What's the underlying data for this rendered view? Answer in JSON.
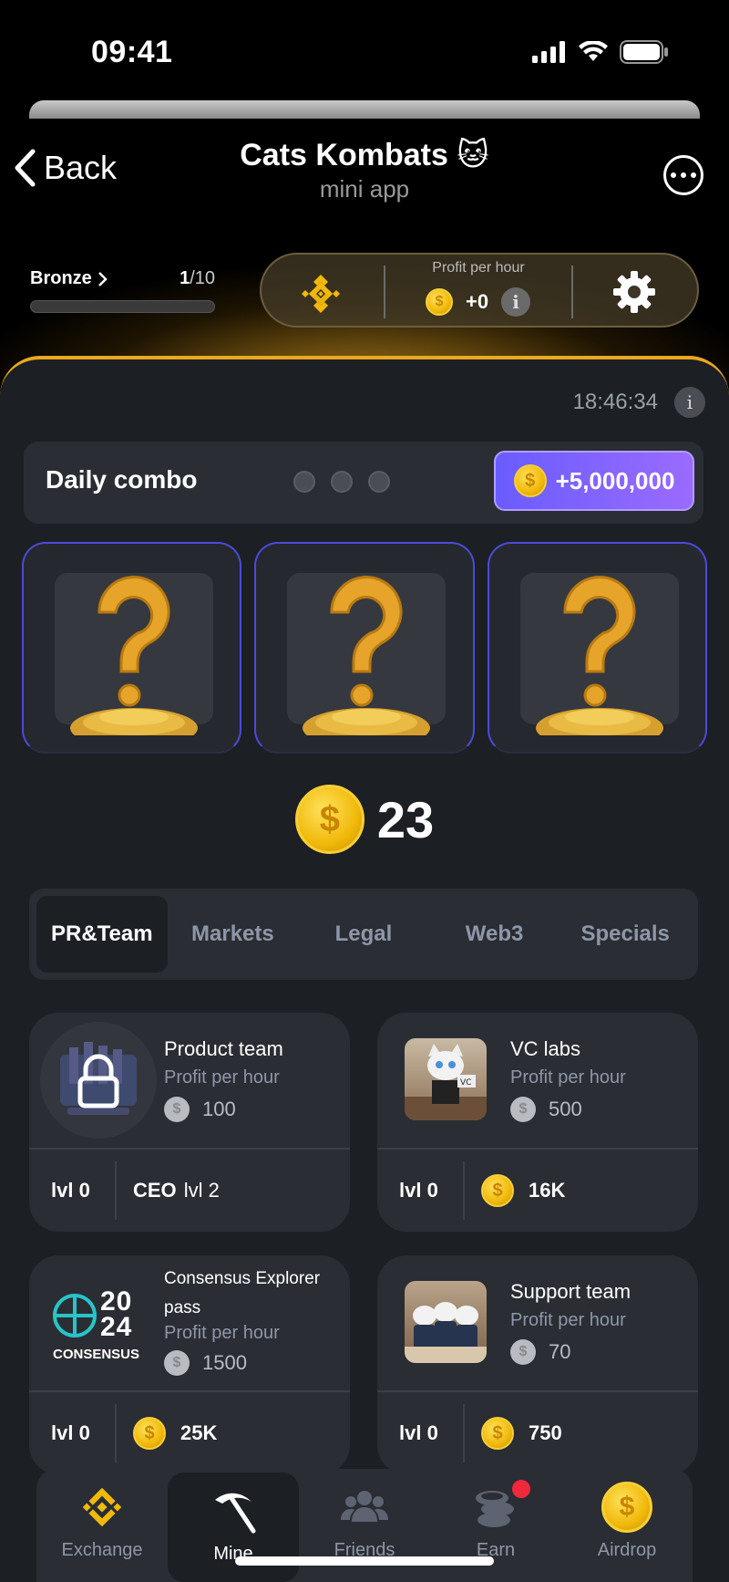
{
  "status_bar": {
    "time": "09:41"
  },
  "header": {
    "back_label": "Back",
    "title": "Cats Kombats 🐱",
    "subtitle": "mini app"
  },
  "level": {
    "name": "Bronze",
    "current": "1",
    "total": "/10",
    "progress": 0.0
  },
  "profit_pill": {
    "label": "Profit per hour",
    "value": "+0",
    "info": "i"
  },
  "timer": {
    "value": "18:46:34",
    "info": "i"
  },
  "daily_combo": {
    "title": "Daily combo",
    "reward": "+5,000,000",
    "slots_filled": 0,
    "slots_total": 3
  },
  "balance": {
    "value": "23"
  },
  "tabs": [
    {
      "label": "PR&Team",
      "active": true
    },
    {
      "label": "Markets",
      "active": false
    },
    {
      "label": "Legal",
      "active": false
    },
    {
      "label": "Web3",
      "active": false
    },
    {
      "label": "Specials",
      "active": false
    }
  ],
  "cards": [
    {
      "name": "Product team",
      "profit_label": "Profit per hour",
      "profit": "100",
      "level": "lvl 0",
      "cost_prefix": "CEO",
      "cost": "lvl 2",
      "locked": true
    },
    {
      "name": "VC labs",
      "profit_label": "Profit per hour",
      "profit": "500",
      "level": "lvl 0",
      "cost": "16K",
      "locked": false
    },
    {
      "name": "Consensus Explorer pass",
      "profit_label": "Profit per hour",
      "profit": "1500",
      "level": "lvl 0",
      "cost": "25K",
      "locked": false,
      "logo_text_top": "20",
      "logo_text_mid": "24",
      "logo_text_bottom": "CONSENSUS"
    },
    {
      "name": "Support team",
      "profit_label": "Profit per hour",
      "profit": "70",
      "level": "lvl 0",
      "cost": "750",
      "locked": false
    }
  ],
  "nav": [
    {
      "label": "Exchange",
      "icon": "binance-icon",
      "active": false
    },
    {
      "label": "Mine",
      "icon": "pickaxe-icon",
      "active": true
    },
    {
      "label": "Friends",
      "icon": "friends-icon",
      "active": false
    },
    {
      "label": "Earn",
      "icon": "coins-icon",
      "active": false,
      "badge": true
    },
    {
      "label": "Airdrop",
      "icon": "coin-icon",
      "active": false
    }
  ],
  "colors": {
    "accent_gold": "#f0b90b",
    "panel_bg": "#1c1f24",
    "card_bg": "#2a2d33",
    "combo_purple": "#7a62ff",
    "muted": "#8e97a8"
  }
}
